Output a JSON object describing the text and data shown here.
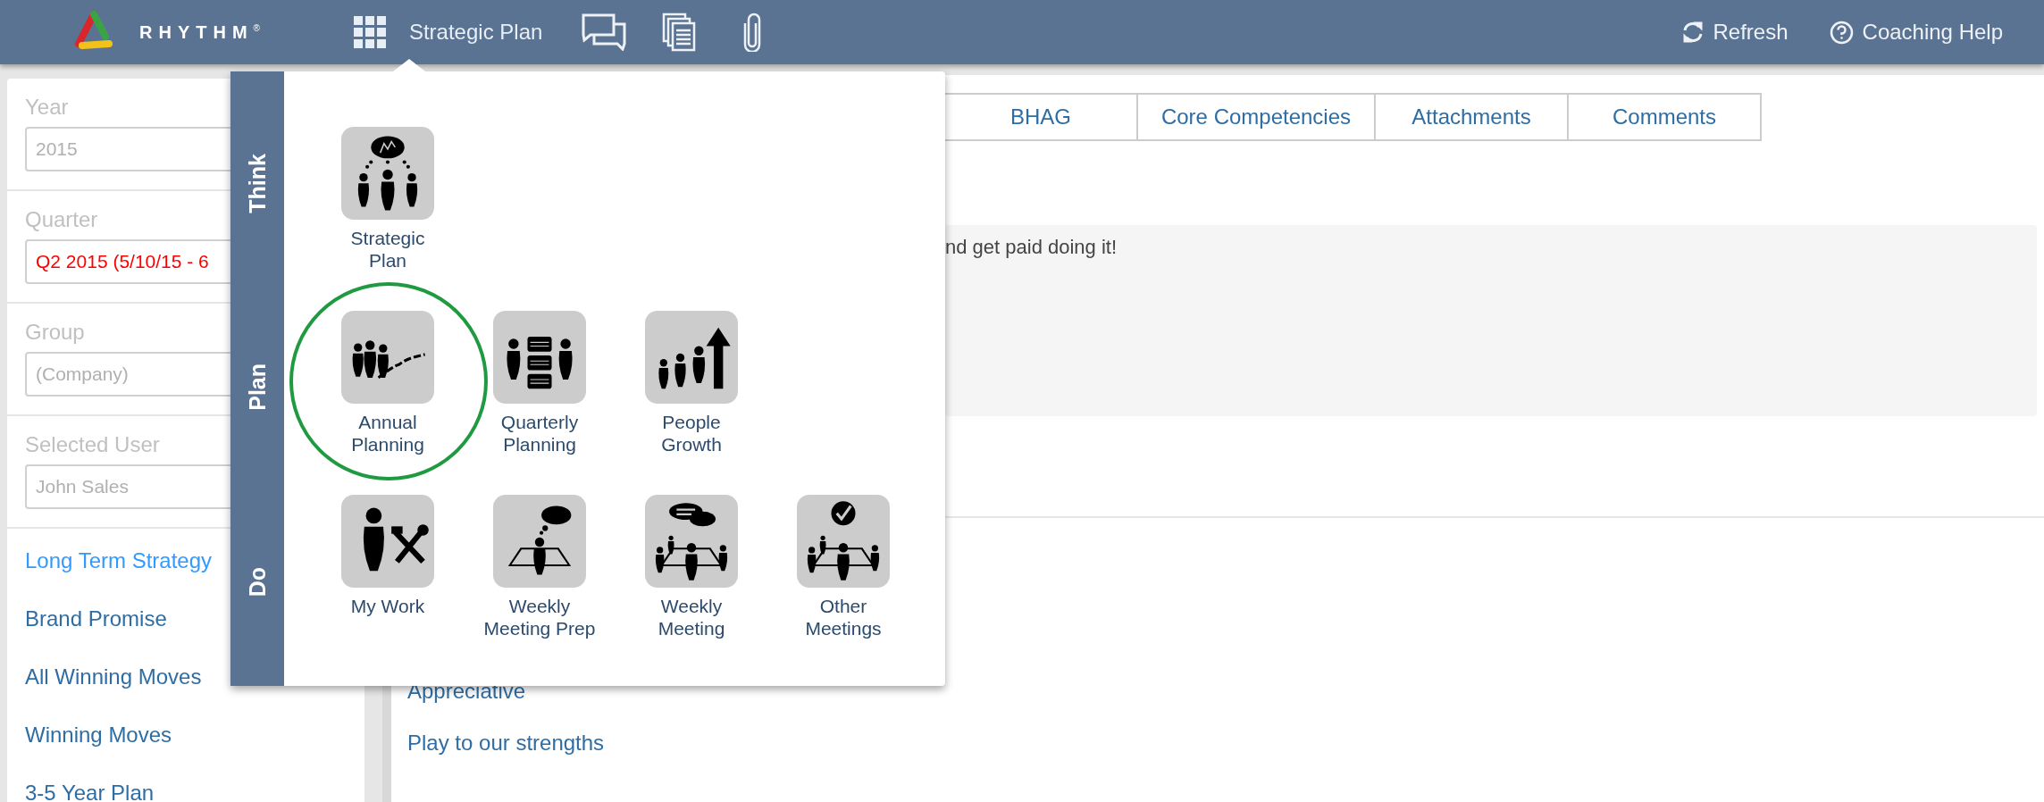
{
  "header": {
    "brand": "RHYTHM$^{®}$",
    "module": "Strategic Plan",
    "actions": [
      {
        "label": "Refresh"
      },
      {
        "label": "Coaching Help"
      }
    ]
  },
  "sidebar": {
    "fields": [
      {
        "label": "Year",
        "value": "2015",
        "color": "#b0b0b0"
      },
      {
        "label": "Quarter",
        "value": "Q2 2015 (5/10/15 - 6",
        "color": "#ff0000"
      },
      {
        "label": "Group",
        "value": "(Company)",
        "color": "#b0b0b0"
      },
      {
        "label": "Selected User",
        "value": "John Sales",
        "color": "#b0b0b0"
      }
    ],
    "links": [
      {
        "label": "Long Term Strategy",
        "selected": true
      },
      {
        "label": "Brand Promise",
        "selected": false
      },
      {
        "label": "All Winning Moves",
        "selected": false
      },
      {
        "label": "Winning Moves",
        "selected": false
      },
      {
        "label": "3-5 Year Plan",
        "selected": false
      }
    ]
  },
  "tabs": [
    "BHAG",
    "Core Competencies",
    "Attachments",
    "Comments"
  ],
  "summary": "nd get paid doing it!",
  "values": [
    "Appreciative",
    "Play to our strengths"
  ],
  "menu": {
    "sections": [
      {
        "label": "Think",
        "items": [
          {
            "label": "Strategic\nPlan",
            "selected": false
          }
        ]
      },
      {
        "label": "Plan",
        "items": [
          {
            "label": "Annual\nPlanning",
            "selected": true
          },
          {
            "label": "Quarterly\nPlanning",
            "selected": false
          },
          {
            "label": "People\nGrowth",
            "selected": false
          }
        ]
      },
      {
        "label": "Do",
        "items": [
          {
            "label": "My Work",
            "selected": false
          },
          {
            "label": "Weekly\nMeeting Prep",
            "selected": false
          },
          {
            "label": "Weekly\nMeeting",
            "selected": false
          },
          {
            "label": "Other\nMeetings",
            "selected": false
          }
        ]
      }
    ]
  }
}
